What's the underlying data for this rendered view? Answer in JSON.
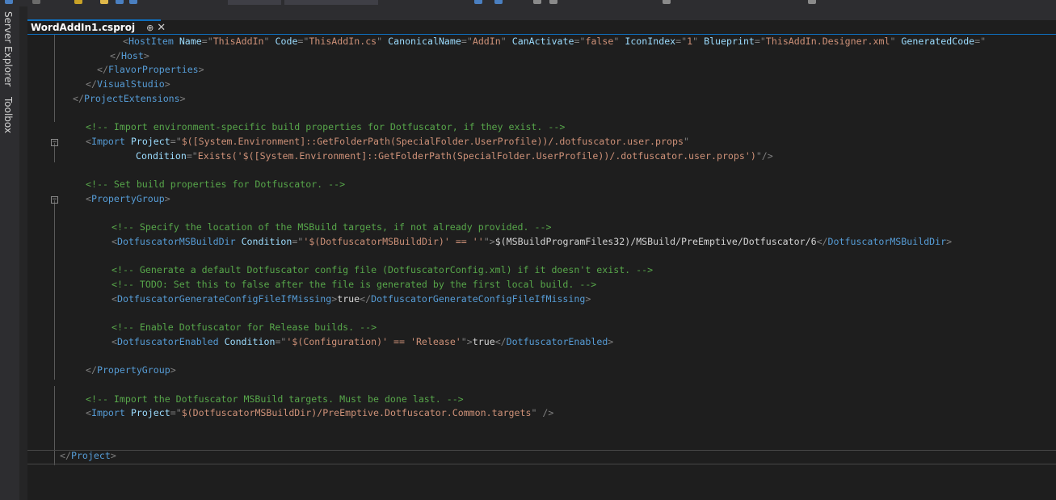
{
  "window": {
    "side_tabs": [
      "Server Explorer",
      "Toolbox"
    ],
    "document_tab": {
      "name": "WordAddIn1.csproj",
      "pin_glyph": "⊕",
      "close_glyph": "✕"
    }
  },
  "colors": {
    "element": "#569cd6",
    "attribute": "#9cdcfe",
    "value": "#ce9178",
    "comment": "#57a64a",
    "text": "#d4d4d4",
    "punct": "#808080",
    "accent": "#0e70c0"
  },
  "code_lines": [
    [
      [
        "t",
        "<"
      ],
      [
        "e",
        "HostItem"
      ],
      [
        "x",
        " "
      ],
      [
        "a",
        "Name"
      ],
      [
        "t",
        "=\""
      ],
      [
        "v",
        "ThisAddIn"
      ],
      [
        "t",
        "\""
      ],
      [
        "x",
        " "
      ],
      [
        "a",
        "Code"
      ],
      [
        "t",
        "=\""
      ],
      [
        "v",
        "ThisAddIn.cs"
      ],
      [
        "t",
        "\""
      ],
      [
        "x",
        " "
      ],
      [
        "a",
        "CanonicalName"
      ],
      [
        "t",
        "=\""
      ],
      [
        "v",
        "AddIn"
      ],
      [
        "t",
        "\""
      ],
      [
        "x",
        " "
      ],
      [
        "a",
        "CanActivate"
      ],
      [
        "t",
        "=\""
      ],
      [
        "v",
        "false"
      ],
      [
        "t",
        "\""
      ],
      [
        "x",
        " "
      ],
      [
        "a",
        "IconIndex"
      ],
      [
        "t",
        "=\""
      ],
      [
        "v",
        "1"
      ],
      [
        "t",
        "\""
      ],
      [
        "x",
        " "
      ],
      [
        "a",
        "Blueprint"
      ],
      [
        "t",
        "=\""
      ],
      [
        "v",
        "ThisAddIn.Designer.xml"
      ],
      [
        "t",
        "\""
      ],
      [
        "x",
        " "
      ],
      [
        "a",
        "GeneratedCode"
      ],
      [
        "t",
        "=\""
      ]
    ],
    [
      [
        "t",
        "</"
      ],
      [
        "e",
        "Host"
      ],
      [
        "t",
        ">"
      ]
    ],
    [
      [
        "t",
        "</"
      ],
      [
        "e",
        "FlavorProperties"
      ],
      [
        "t",
        ">"
      ]
    ],
    [
      [
        "t",
        "</"
      ],
      [
        "e",
        "VisualStudio"
      ],
      [
        "t",
        ">"
      ]
    ],
    [
      [
        "t",
        "</"
      ],
      [
        "e",
        "ProjectExtensions"
      ],
      [
        "t",
        ">"
      ]
    ],
    [],
    [
      [
        "c",
        "<!-- Import environment-specific build properties for Dotfuscator, if they exist. -->"
      ]
    ],
    [
      [
        "t",
        "<"
      ],
      [
        "e",
        "Import"
      ],
      [
        "x",
        " "
      ],
      [
        "a",
        "Project"
      ],
      [
        "t",
        "=\""
      ],
      [
        "v",
        "$([System.Environment]::GetFolderPath(SpecialFolder.UserProfile))/.dotfuscator.user.props"
      ],
      [
        "t",
        "\""
      ]
    ],
    [
      [
        "a",
        "Condition"
      ],
      [
        "t",
        "=\""
      ],
      [
        "v",
        "Exists('$([System.Environment]::GetFolderPath(SpecialFolder.UserProfile))/.dotfuscator.user.props')"
      ],
      [
        "t",
        "\"/>"
      ]
    ],
    [],
    [
      [
        "c",
        "<!-- Set build properties for Dotfuscator. -->"
      ]
    ],
    [
      [
        "t",
        "<"
      ],
      [
        "e",
        "PropertyGroup"
      ],
      [
        "t",
        ">"
      ]
    ],
    [],
    [
      [
        "c",
        "<!-- Specify the location of the MSBuild targets, if not already provided. -->"
      ]
    ],
    [
      [
        "t",
        "<"
      ],
      [
        "e",
        "DotfuscatorMSBuildDir"
      ],
      [
        "x",
        " "
      ],
      [
        "a",
        "Condition"
      ],
      [
        "t",
        "=\""
      ],
      [
        "v",
        "'$(DotfuscatorMSBuildDir)' == ''"
      ],
      [
        "t",
        "\">"
      ],
      [
        "x",
        "$(MSBuildProgramFiles32)/MSBuild/PreEmptive/Dotfuscator/6"
      ],
      [
        "t",
        "</"
      ],
      [
        "e",
        "DotfuscatorMSBuildDir"
      ],
      [
        "t",
        ">"
      ]
    ],
    [],
    [
      [
        "c",
        "<!-- Generate a default Dotfuscator config file (DotfuscatorConfig.xml) if it doesn't exist. -->"
      ]
    ],
    [
      [
        "c",
        "<!-- TODO: Set this to false after the file is generated by the first local build. -->"
      ]
    ],
    [
      [
        "t",
        "<"
      ],
      [
        "e",
        "DotfuscatorGenerateConfigFileIfMissing"
      ],
      [
        "t",
        ">"
      ],
      [
        "x",
        "true"
      ],
      [
        "t",
        "</"
      ],
      [
        "e",
        "DotfuscatorGenerateConfigFileIfMissing"
      ],
      [
        "t",
        ">"
      ]
    ],
    [],
    [
      [
        "c",
        "<!-- Enable Dotfuscator for Release builds. -->"
      ]
    ],
    [
      [
        "t",
        "<"
      ],
      [
        "e",
        "DotfuscatorEnabled"
      ],
      [
        "x",
        " "
      ],
      [
        "a",
        "Condition"
      ],
      [
        "t",
        "=\""
      ],
      [
        "v",
        "'$(Configuration)' == 'Release'"
      ],
      [
        "t",
        "\">"
      ],
      [
        "x",
        "true"
      ],
      [
        "t",
        "</"
      ],
      [
        "e",
        "DotfuscatorEnabled"
      ],
      [
        "t",
        ">"
      ]
    ],
    [],
    [
      [
        "t",
        "</"
      ],
      [
        "e",
        "PropertyGroup"
      ],
      [
        "t",
        ">"
      ]
    ],
    [],
    [
      [
        "c",
        "<!-- Import the Dotfuscator MSBuild targets. Must be done last. -->"
      ]
    ],
    [
      [
        "t",
        "<"
      ],
      [
        "e",
        "Import"
      ],
      [
        "x",
        " "
      ],
      [
        "a",
        "Project"
      ],
      [
        "t",
        "=\""
      ],
      [
        "v",
        "$(DotfuscatorMSBuildDir)/PreEmptive.Dotfuscator.Common.targets"
      ],
      [
        "t",
        "\" />"
      ]
    ],
    [],
    [],
    [
      [
        "t",
        "</"
      ],
      [
        "e",
        "Project"
      ],
      [
        "t",
        ">"
      ]
    ]
  ]
}
